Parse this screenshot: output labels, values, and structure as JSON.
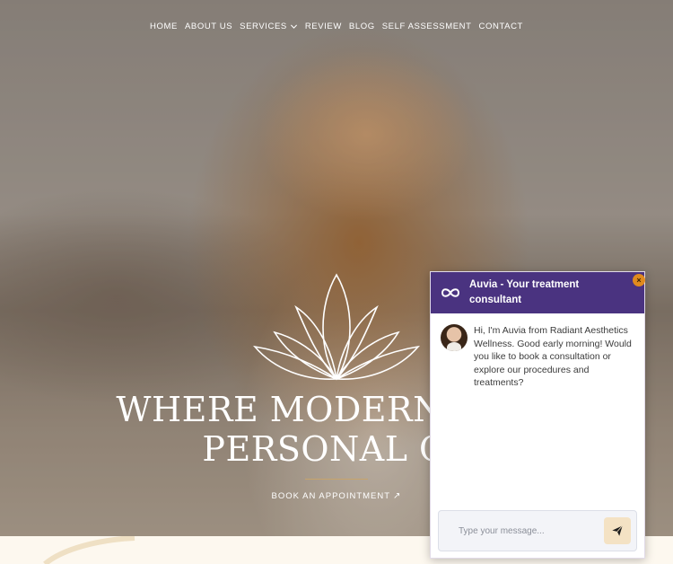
{
  "nav": {
    "items": [
      {
        "label": "HOME",
        "has_dropdown": false
      },
      {
        "label": "ABOUT US",
        "has_dropdown": false
      },
      {
        "label": "SERVICES",
        "has_dropdown": true
      },
      {
        "label": "REVIEW",
        "has_dropdown": false
      },
      {
        "label": "BLOG",
        "has_dropdown": false
      },
      {
        "label": "SELF ASSESSMENT",
        "has_dropdown": false
      },
      {
        "label": "CONTACT",
        "has_dropdown": false
      }
    ]
  },
  "hero": {
    "headline_line1": "WHERE MODERN MEDI",
    "headline_line2": "PERSONAL CA",
    "cta_label": "BOOK AN APPOINTMENT",
    "cta_icon": "arrow-up-right-icon",
    "logo_icon": "lotus-icon"
  },
  "chat": {
    "title": "Auvia - Your treatment consultant",
    "close_label": "×",
    "logo_icon": "infinity-icon",
    "message": "Hi, I'm Auvia from Radiant Aesthetics Wellness. Good early morning! Would you like to book a consultation or explore our procedures and treatments?",
    "input_placeholder": "Type your message...",
    "send_icon": "send-icon"
  },
  "colors": {
    "chat_header": "#4a3380",
    "close_button": "#e08a1e",
    "send_button": "#f4e2c4",
    "accent_gold": "#c8a46a",
    "cream": "#fdf8ef"
  }
}
